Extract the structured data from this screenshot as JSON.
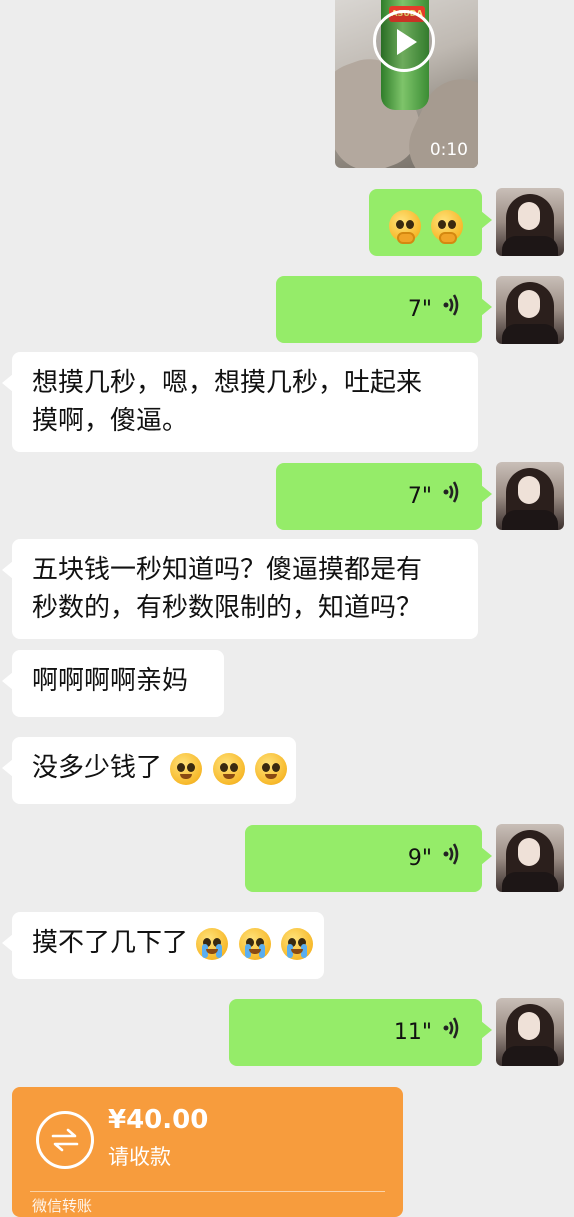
{
  "video": {
    "duration": "0:10",
    "bottle_label": "ASUDA"
  },
  "messages": [
    {
      "id": "m1",
      "type": "voice",
      "duration": "7\""
    },
    {
      "id": "m2",
      "text_line1": "想摸几秒，嗯，想摸几秒，吐起来",
      "text_line2": "摸啊，傻逼。"
    },
    {
      "id": "m3",
      "type": "voice",
      "duration": "7\""
    },
    {
      "id": "m4",
      "text_line1": "五块钱一秒知道吗？傻逼摸都是有",
      "text_line2": "秒数的，有秒数限制的，知道吗？"
    },
    {
      "id": "m5",
      "text": "啊啊啊啊亲妈"
    },
    {
      "id": "m6",
      "text": "没多少钱了"
    },
    {
      "id": "m7",
      "type": "voice",
      "duration": "9\""
    },
    {
      "id": "m8",
      "text": "摸不了几下了"
    },
    {
      "id": "m9",
      "type": "voice",
      "duration": "11\""
    }
  ],
  "transfer": {
    "amount": "¥40.00",
    "status": "请收款",
    "footer": "微信转账"
  },
  "colors": {
    "my_bubble": "#95ec69",
    "other_bubble": "#ffffff",
    "background": "#ededed",
    "transfer": "#f79c3d"
  }
}
